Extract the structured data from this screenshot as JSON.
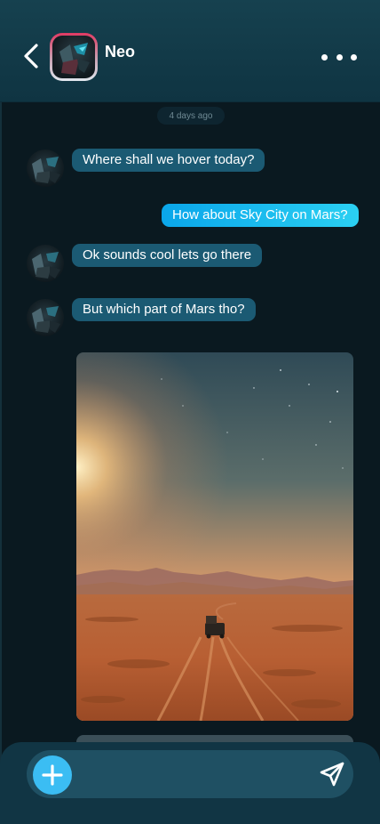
{
  "header": {
    "contact_name": "Neo",
    "back_icon": "chevron-left-icon",
    "more_icon": "more-horizontal-icon"
  },
  "chat": {
    "date_separator": "4 days ago",
    "messages": [
      {
        "direction": "incoming",
        "text": "Where shall we hover today?"
      },
      {
        "direction": "outgoing",
        "text": "How about Sky City on Mars?"
      },
      {
        "direction": "incoming",
        "text": "Ok sounds cool lets go there"
      },
      {
        "direction": "incoming",
        "text": "But which part of Mars tho?"
      }
    ],
    "attachment": {
      "type": "image",
      "subject": "desert road at sunset with a jeep"
    }
  },
  "composer": {
    "placeholder": "",
    "add_icon": "plus-icon",
    "send_icon": "send-icon"
  },
  "colors": {
    "header_bg": "#16414f",
    "chat_bg": "#0a1920",
    "incoming_bubble": "#1b5a73",
    "outgoing_bubble": "#0aa6ea",
    "add_button": "#3bbdf3"
  }
}
